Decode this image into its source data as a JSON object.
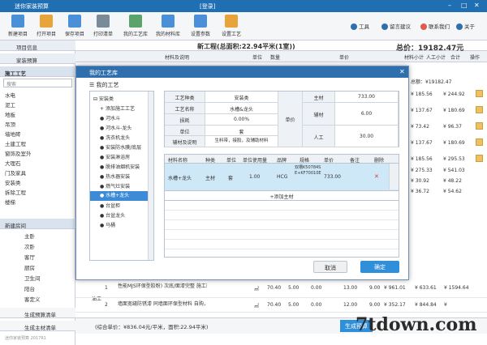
{
  "app": {
    "title": "迷你家装预算",
    "login": "[登录]",
    "window_controls": [
      "–",
      "□",
      "✕"
    ]
  },
  "toolbar": {
    "left": [
      {
        "label": "新建项目",
        "color": "#4a90d9"
      },
      {
        "label": "打开项目",
        "color": "#e8a33a"
      },
      {
        "label": "保存项目",
        "color": "#4a90d9"
      },
      {
        "label": "打印清单",
        "color": "#7b8a99"
      },
      {
        "label": "我的工艺库",
        "color": "#5aa36b"
      },
      {
        "label": "我的材料库",
        "color": "#4a90d9"
      },
      {
        "label": "设置参数",
        "color": "#4a90d9"
      },
      {
        "label": "设置工艺",
        "color": "#e8a33a"
      }
    ],
    "right": [
      {
        "label": "工具",
        "color": "#2f6fae"
      },
      {
        "label": "留言建议",
        "color": "#2f6fae"
      },
      {
        "label": "联系我们",
        "color": "#e05a4f"
      },
      {
        "label": "关于",
        "color": "#2f6fae"
      }
    ]
  },
  "left_panel": {
    "tabs": [
      "项目信息",
      "家装预算"
    ],
    "section1": "施工工艺",
    "search_placeholder": "搜索",
    "items": [
      "水电",
      "泥工",
      "地板",
      "吊顶",
      "墙地砖",
      "土建工程",
      "窗饰及室外",
      "大理石",
      "门及家具",
      "安装类",
      "拆除工程",
      "楼梯"
    ],
    "section2": "新建房间",
    "rooms": [
      "主卧",
      "次卧",
      "客厅",
      "厨房",
      "卫生间",
      "阳台",
      "客定义"
    ],
    "footer": [
      "生成预算清单",
      "生成主材清单"
    ],
    "version": "迷你家装预算 2017R1"
  },
  "main": {
    "heading": "新工程(总面积:22.94平米(1室))",
    "total": "总价：19182.47元",
    "columns": [
      "材料及说明",
      "单位",
      "数量",
      "单价",
      "材料小计",
      "人工小计",
      "合计",
      "操作"
    ],
    "right_values": [
      {
        "a": "¥ 185.56",
        "b": "¥ 244.92"
      },
      {
        "a": "¥ 137.67",
        "b": "¥ 180.69"
      },
      {
        "a": "¥ 73.42",
        "b": "¥ 96.37"
      },
      {
        "a": "¥ 137.67",
        "b": "¥ 180.69"
      },
      {
        "a": "¥ 185.56",
        "b": "¥ 295.53"
      },
      {
        "a": "¥ 275.33",
        "b": "¥ 541.03"
      },
      {
        "a": "¥ 30.92",
        "b": "¥ 48.22"
      },
      {
        "a": "¥ 36.72",
        "b": "¥ 54.62"
      }
    ],
    "summary_row": "总额：¥19182.47",
    "bottom_rows": [
      {
        "no": "1",
        "desc": "性能MJS环保型胶粉) 次底/面漆完整 施工环保 额外次基",
        "unit": "㎡",
        "qty": "70.40",
        "price": "5.00",
        "c1": "0.00",
        "c2": "13.00",
        "c3": "9.00",
        "c4": "¥ 961.01",
        "c5": "¥ 633.61",
        "c6": "¥ 1594.64"
      },
      {
        "no": "2",
        "desc": "墙面宽缝防锈漆 同墙面环保型材料 自购，中南801胶水",
        "unit": "㎡",
        "qty": "70.40",
        "price": "5.00",
        "c1": "0.00",
        "c2": "12.00",
        "c3": "9.00",
        "c4": "¥ 352.17",
        "c5": "¥ 844.84",
        "c6": "¥"
      }
    ],
    "bottom_cat": "油工",
    "footer_text": "(综合单价：¥836.04元/平米，面积:22.94平米)",
    "generate_button": "生成预算"
  },
  "modal": {
    "title": "我的工艺库",
    "tree_title": "我的工艺",
    "tree": [
      {
        "label": "安装类",
        "level": 0
      },
      {
        "label": "添加施工工艺",
        "level": 1
      },
      {
        "label": "河水斗",
        "level": 1
      },
      {
        "label": "河水斗-龙头",
        "level": 1
      },
      {
        "label": "洗衣机龙头",
        "level": 1
      },
      {
        "label": "安装防水膜/底层",
        "level": 1
      },
      {
        "label": "安装淋浴房",
        "level": 1
      },
      {
        "label": "脱排油烟机安装",
        "level": 1
      },
      {
        "label": "热水器安装",
        "level": 1
      },
      {
        "label": "燃气灶安装",
        "level": 1
      },
      {
        "label": "水槽+龙头",
        "level": 1,
        "selected": true
      },
      {
        "label": "台盆柜",
        "level": 1
      },
      {
        "label": "台盆龙头",
        "level": 1
      },
      {
        "label": "马桶",
        "level": 1
      }
    ],
    "form": {
      "craft_type_label": "工艺种类",
      "craft_type": "安装类",
      "craft_name_label": "工艺名称",
      "craft_name": "水槽&龙头",
      "loss_label": "损耗",
      "loss": "0.00%",
      "unit_label": "单位",
      "unit": "套",
      "note_label": "辅材及说明",
      "note": "生料带，接胶，及辅助材料",
      "price_label": "单价",
      "main_label": "主材",
      "main_val": "733.00",
      "aux_label": "辅材",
      "aux_val": "6.00",
      "labor_label": "人工",
      "labor_val": "30.00"
    },
    "mat_cols": [
      "材料名称",
      "种类",
      "单位",
      "单位使用量",
      "品牌",
      "规格",
      "单价",
      "备注",
      "删除"
    ],
    "mat_row": {
      "name": "水槽+龙头",
      "kind": "主材",
      "unit": "套",
      "use": "1.00",
      "brand": "HCG",
      "spec": "双槽K50784SE+KF70010E",
      "price": "733.00",
      "note": "",
      "del": "✕"
    },
    "add_main": "+添加主材",
    "cancel": "取消",
    "ok": "确定"
  },
  "watermark": "7tdown.com"
}
